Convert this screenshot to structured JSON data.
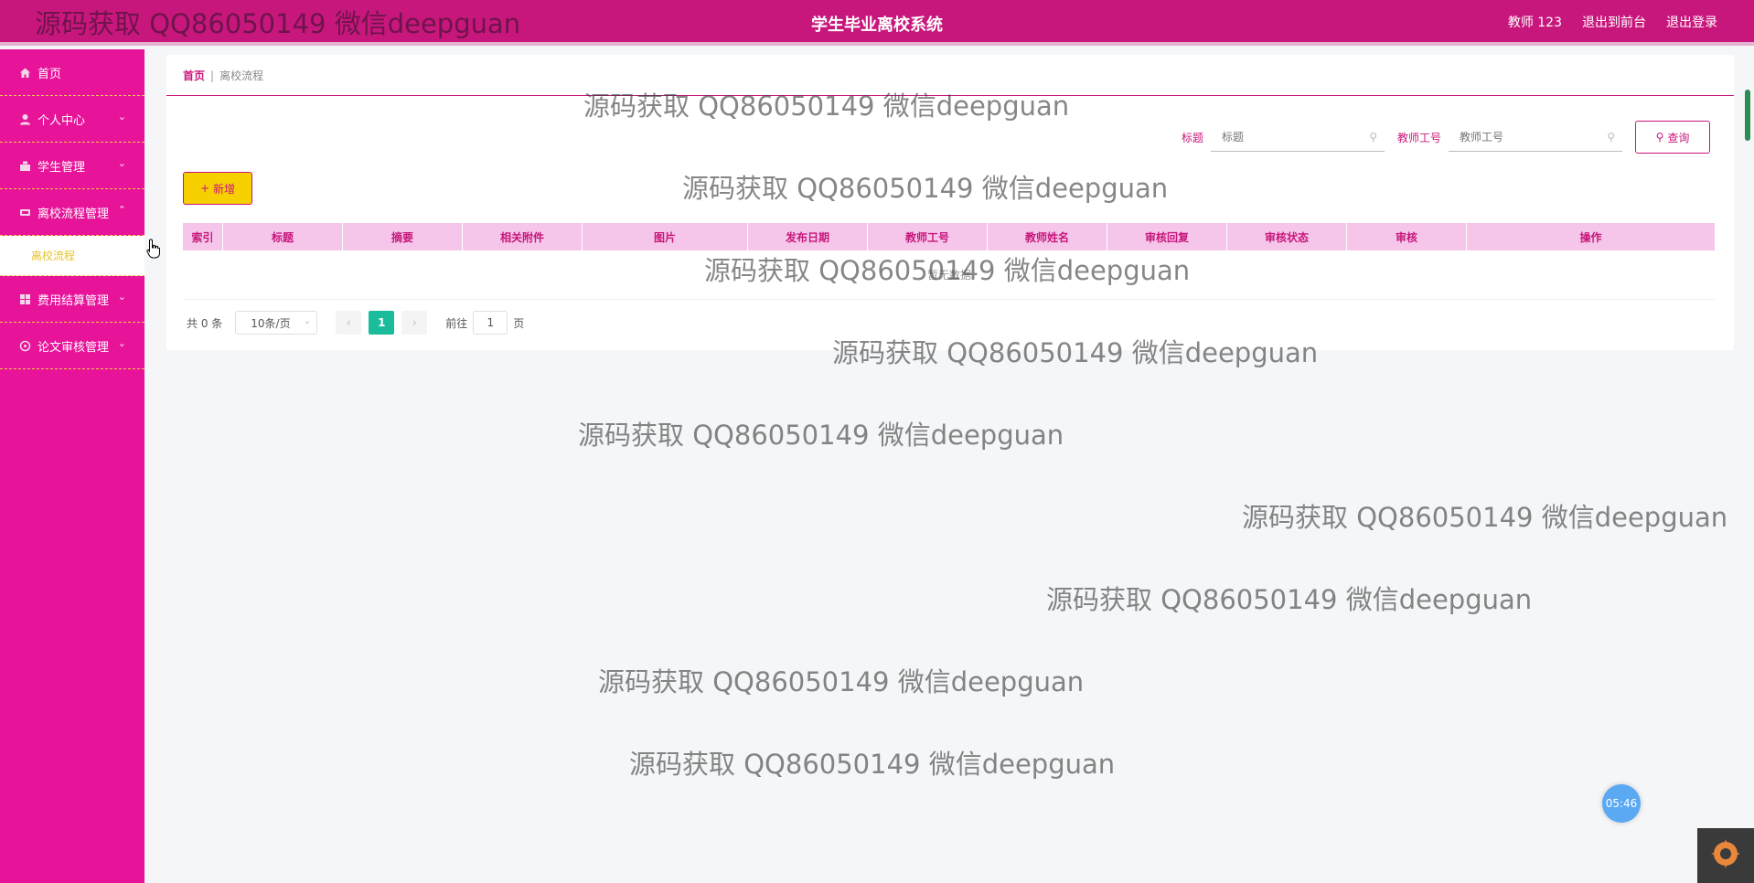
{
  "header": {
    "title": "学生毕业离校系统",
    "user": "教师 123",
    "to_front": "退出到前台",
    "logout": "退出登录"
  },
  "sidebar": {
    "items": [
      {
        "label": "首页",
        "icon": "home-icon"
      },
      {
        "label": "个人中心",
        "icon": "user-icon"
      },
      {
        "label": "学生管理",
        "icon": "student-icon"
      },
      {
        "label": "离校流程管理",
        "icon": "flow-icon"
      },
      {
        "label": "费用结算管理",
        "icon": "grid-icon"
      },
      {
        "label": "论文审核管理",
        "icon": "paper-icon"
      }
    ],
    "sub_active": "离校流程"
  },
  "breadcrumb": {
    "home": "首页",
    "sep": "|",
    "current": "离校流程"
  },
  "search": {
    "title_label": "标题",
    "title_placeholder": "标题",
    "teacher_label": "教师工号",
    "teacher_placeholder": "教师工号",
    "button": "查询"
  },
  "add_button": "新增",
  "table": {
    "columns": [
      "索引",
      "标题",
      "摘要",
      "相关附件",
      "图片",
      "发布日期",
      "教师工号",
      "教师姓名",
      "审核回复",
      "审核状态",
      "审核",
      "操作"
    ],
    "empty_text": "暂无数据"
  },
  "pagination": {
    "total": "共 0 条",
    "page_size": "10条/页",
    "current_page": "1",
    "goto_label": "前往",
    "goto_value": "1",
    "page_suffix": "页"
  },
  "watermark": "源码获取 QQ86050149 微信deepguan",
  "clock": "05:46",
  "colors": {
    "primary": "#c8177c",
    "sidebar": "#e7149a",
    "accent": "#f7d000",
    "table_head": "#f5c6ea",
    "active_page": "#1abc9c"
  }
}
